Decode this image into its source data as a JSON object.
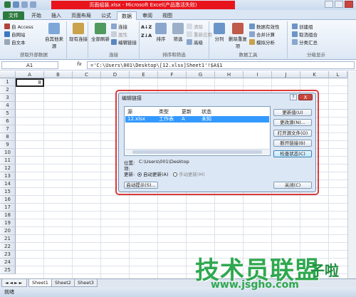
{
  "app": {
    "title": "页面组装.xlsx - Microsoft Excel(产品激活失败)"
  },
  "tabs": [
    "文件",
    "开始",
    "插入",
    "页面布局",
    "公式",
    "数据",
    "审阅",
    "视图"
  ],
  "ribbon": {
    "group1": {
      "items": [
        "自 Access",
        "自网站",
        "自文本"
      ],
      "big": [
        "自其他来源"
      ],
      "label": "获取外部数据"
    },
    "group2": {
      "big": [
        "现有连接"
      ]
    },
    "group3": {
      "big": [
        "全部刷新"
      ],
      "items": [
        "连接",
        "属性",
        "编辑链接"
      ],
      "label": "连接"
    },
    "group4": {
      "big": [
        "排序",
        "筛选"
      ],
      "items": [
        "清除",
        "重新应用",
        "高级"
      ],
      "label": "排序和筛选"
    },
    "group5": {
      "big": [
        "分列",
        "删除重复项"
      ],
      "items": [
        "数据有效性",
        "合并计算",
        "模拟分析"
      ],
      "label": "数据工具"
    },
    "group6": {
      "items": [
        "创建组",
        "取消组合",
        "分类汇总"
      ],
      "label": "分级显示"
    }
  },
  "formula_bar": {
    "name": "A1",
    "fx": "fx",
    "formula": "='C:\\Users\\001\\Desktop\\[12.xlsx]Sheet1'!$A$1"
  },
  "grid": {
    "columns": [
      "A",
      "B",
      "C",
      "D",
      "E",
      "F",
      "G",
      "H",
      "I",
      "J",
      "K",
      "L"
    ],
    "rows": [
      "1",
      "2",
      "3",
      "4",
      "5",
      "6",
      "7",
      "8",
      "9",
      "10",
      "11",
      "12",
      "13",
      "14",
      "15",
      "16",
      "17",
      "18",
      "19",
      "20",
      "21",
      "22",
      "23",
      "24",
      "25"
    ],
    "a1_value": "8"
  },
  "sheets": [
    "Sheet1",
    "Sheet2",
    "Sheet3"
  ],
  "status": "就绪",
  "dialog": {
    "title": "编辑链接",
    "help": "?",
    "close": "X",
    "headers": [
      "源",
      "类型",
      "更新",
      "状态"
    ],
    "row": [
      "12.xlsx",
      "工作表",
      "A",
      "未知"
    ],
    "buttons": [
      "更新值(U)",
      "更改源(N)...",
      "打开源文件(O)",
      "断开链接(B)",
      "检查状态(C)"
    ],
    "location_label": "位置:",
    "location_value": "C:\\Users\\001\\Desktop",
    "item_label": "项:",
    "update_label": "更新:",
    "auto_update": "自动更新(A)",
    "manual_update": "手动更新(M)",
    "startup_button": "启动提示(S)...",
    "close_button": "关闭(C)"
  },
  "watermark": {
    "text": "技术员联盟",
    "suffix": "子啦",
    "url": "www.jsgho.com"
  }
}
